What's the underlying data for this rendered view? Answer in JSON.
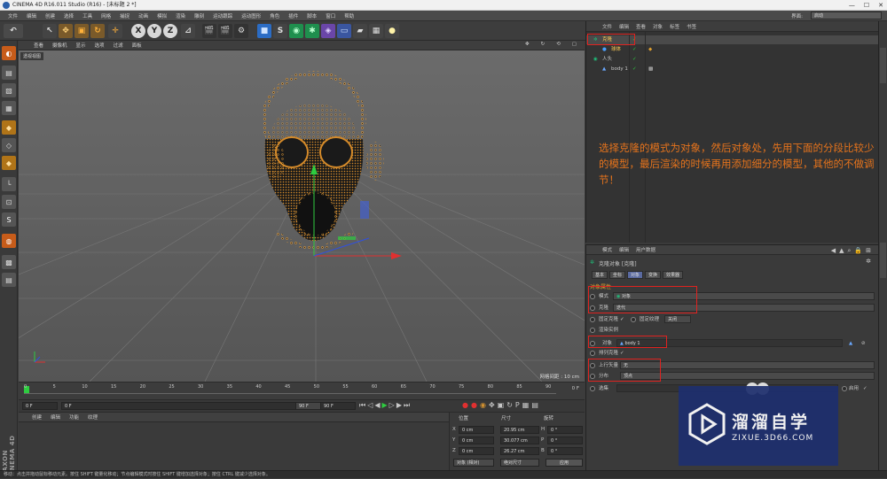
{
  "titlebar": {
    "title": "CINEMA 4D R16.011 Studio (R16) - [未标题 2 *]",
    "min": "—",
    "max": "☐",
    "close": "✕"
  },
  "menu": [
    "文件",
    "编辑",
    "创建",
    "选择",
    "工具",
    "网格",
    "捕捉",
    "动画",
    "模拟",
    "渲染",
    "雕刻",
    "运动跟踪",
    "运动图形",
    "角色",
    "插件",
    "脚本",
    "窗口",
    "帮助"
  ],
  "layout": {
    "label": "界面:",
    "value": "启动"
  },
  "toolbar": {
    "axis": [
      "X",
      "Y",
      "Z"
    ]
  },
  "viewport": {
    "menu": [
      "查看",
      "摄像机",
      "显示",
      "选项",
      "过滤",
      "面板"
    ],
    "label": "透视视图",
    "grid_spacing": "网格间距 : 10 cm"
  },
  "timeline": {
    "ticks": [
      "0",
      "5",
      "10",
      "15",
      "20",
      "25",
      "30",
      "35",
      "40",
      "45",
      "50",
      "55",
      "60",
      "65",
      "70",
      "75",
      "80",
      "85",
      "90"
    ],
    "frame_end": "0 F"
  },
  "playbar": {
    "start": "0 F",
    "current": "0 F",
    "end": "90 F",
    "max": "90 F"
  },
  "material": {
    "menu": [
      "创建",
      "编辑",
      "功能",
      "纹理"
    ],
    "brand": "MAXON CINEMA 4D"
  },
  "coords": {
    "headers": [
      "位置",
      "尺寸",
      "旋转"
    ],
    "rows": [
      {
        "axis": "X",
        "pos": "0 cm",
        "size": "20.95 cm",
        "rot_label": "H",
        "rot": "0 °"
      },
      {
        "axis": "Y",
        "pos": "0 cm",
        "size": "30.077 cm",
        "rot_label": "P",
        "rot": "0 °"
      },
      {
        "axis": "Z",
        "pos": "0 cm",
        "size": "26.27 cm",
        "rot_label": "B",
        "rot": "0 °"
      }
    ],
    "mode": "对象 (相对)",
    "size_mode": "绝对尺寸",
    "apply": "应用"
  },
  "objects": {
    "tabs": [
      "文件",
      "编辑",
      "查看",
      "对象",
      "标签",
      "书签"
    ],
    "rows": [
      {
        "name": "克隆",
        "indent": 0
      },
      {
        "name": "球体",
        "indent": 1
      },
      {
        "name": "人头",
        "indent": 0
      },
      {
        "name": "body 1",
        "indent": 1
      }
    ]
  },
  "annotation": "选择克隆的模式为对象，然后对象处，先用下面的分段比较少的模型，最后渲染的时候再用添加细分的模型，其他的不做调节！",
  "attributes": {
    "menu": [
      "模式",
      "编辑",
      "用户数据"
    ],
    "title": "克隆对象 [克隆]",
    "tabs": [
      "基本",
      "坐标",
      "对象",
      "变换",
      "效果器"
    ],
    "section": "对象属性",
    "mode_label": "模式",
    "mode_value": "对象",
    "clone_label": "克隆",
    "clone_value": "迭代",
    "fix_clone": "固定克隆",
    "fix_texture": "固定纹理",
    "fix_texture_value": "关闭",
    "render_instance": "渲染实例",
    "object_label": "对象",
    "object_value": "body 1",
    "align_clone": "排列克隆",
    "up_vector_label": "上行矢量",
    "up_vector_value": "无",
    "distribution_label": "分布",
    "distribution_value": "顶点",
    "selection_label": "选集",
    "surface_label": "表面",
    "enable_label": "启用"
  },
  "watermark": {
    "title": "溜溜自学",
    "subtitle": "ZIXUE.3D66.COM"
  },
  "status": "移动：点击并拖动鼠标移动元素。按住 SHIFT 键量化移动；节点编辑模式时按住 SHIFT 键增加选择对象；按住 CTRL 键减少选择对象。"
}
